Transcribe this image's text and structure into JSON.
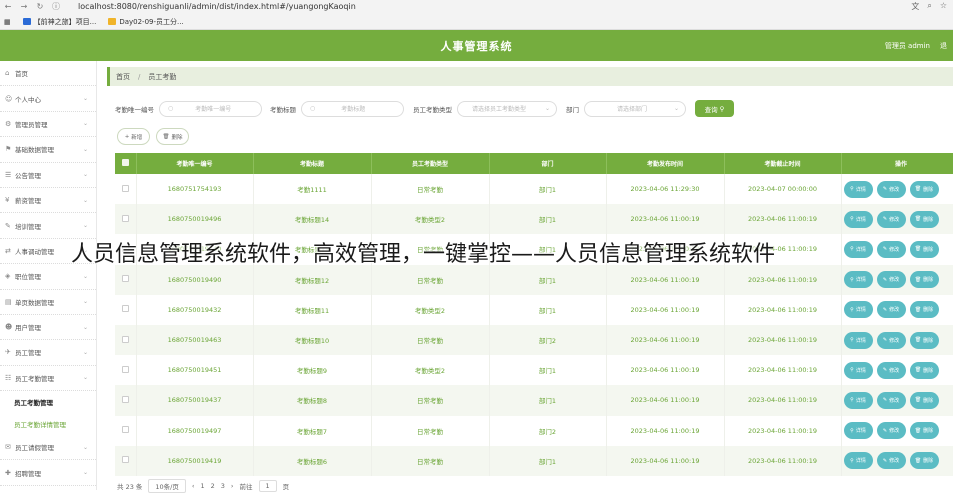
{
  "browser": {
    "url": "localhost:8080/renshiguanli/admin/dist/index.html#/yuangongKaoqin",
    "bookmarks": [
      "【前神之旅】项目...",
      "Day02-09-员工分..."
    ]
  },
  "header": {
    "title": "人事管理系统",
    "user": "管理员 admin",
    "logout": "退"
  },
  "sidebar": {
    "items": [
      {
        "label": "首页",
        "icon": "home-icon",
        "chevron": false
      },
      {
        "label": "个人中心",
        "icon": "user-icon",
        "chevron": true
      },
      {
        "label": "管理员管理",
        "icon": "admin-icon",
        "chevron": true
      },
      {
        "label": "基础数据管理",
        "icon": "flag-icon",
        "chevron": true
      },
      {
        "label": "公告管理",
        "icon": "notice-icon",
        "chevron": true
      },
      {
        "label": "薪资管理",
        "icon": "salary-icon",
        "chevron": true
      },
      {
        "label": "培训管理",
        "icon": "train-icon",
        "chevron": true
      },
      {
        "label": "人事调动管理",
        "icon": "transfer-icon",
        "chevron": true
      },
      {
        "label": "职位管理",
        "icon": "position-icon",
        "chevron": true
      },
      {
        "label": "单页数据管理",
        "icon": "page-icon",
        "chevron": true
      },
      {
        "label": "用户管理",
        "icon": "users-icon",
        "chevron": true
      },
      {
        "label": "员工管理",
        "icon": "staff-icon",
        "chevron": true
      },
      {
        "label": "员工考勤管理",
        "icon": "attendance-icon",
        "chevron": true
      }
    ],
    "sub_items": [
      "员工考勤管理",
      "员工考勤详情管理"
    ],
    "after_items": [
      {
        "label": "员工请假管理",
        "icon": "leave-icon",
        "chevron": true
      },
      {
        "label": "招聘管理",
        "icon": "recruit-icon",
        "chevron": true
      }
    ]
  },
  "breadcrumb": {
    "home": "首页",
    "current": "员工考勤"
  },
  "search": {
    "f1_label": "考勤唯一编号",
    "f1_placeholder": "考勤唯一编号",
    "f2_label": "考勤标题",
    "f2_placeholder": "考勤标题",
    "f3_label": "员工考勤类型",
    "f3_placeholder": "请选择员工考勤类型",
    "f4_label": "部门",
    "f4_placeholder": "请选择部门",
    "search_btn": "查询"
  },
  "actions": {
    "add": "新增",
    "delete": "删除"
  },
  "table": {
    "columns": [
      "考勤唯一编号",
      "考勤标题",
      "员工考勤类型",
      "部门",
      "考勤发布时间",
      "考勤截止时间",
      "操作"
    ],
    "rows": [
      [
        "1680751754193",
        "考勤1111",
        "日常考勤",
        "部门1",
        "2023-04-06 11:29:30",
        "2023-04-07 00:00:00"
      ],
      [
        "1680750019496",
        "考勤标题14",
        "考勤类型2",
        "部门1",
        "2023-04-06 11:00:19",
        "2023-04-06 11:00:19"
      ],
      [
        "1680750019440",
        "考勤标题13",
        "日常考勤",
        "部门1",
        "2023-04-06 11:00:19",
        "2023-04-06 11:00:19"
      ],
      [
        "1680750019490",
        "考勤标题12",
        "日常考勤",
        "部门1",
        "2023-04-06 11:00:19",
        "2023-04-06 11:00:19"
      ],
      [
        "1680750019432",
        "考勤标题11",
        "考勤类型2",
        "部门1",
        "2023-04-06 11:00:19",
        "2023-04-06 11:00:19"
      ],
      [
        "1680750019463",
        "考勤标题10",
        "日常考勤",
        "部门2",
        "2023-04-06 11:00:19",
        "2023-04-06 11:00:19"
      ],
      [
        "1680750019451",
        "考勤标题9",
        "考勤类型2",
        "部门1",
        "2023-04-06 11:00:19",
        "2023-04-06 11:00:19"
      ],
      [
        "1680750019437",
        "考勤标题8",
        "日常考勤",
        "部门1",
        "2023-04-06 11:00:19",
        "2023-04-06 11:00:19"
      ],
      [
        "1680750019497",
        "考勤标题7",
        "日常考勤",
        "部门2",
        "2023-04-06 11:00:19",
        "2023-04-06 11:00:19"
      ],
      [
        "1680750019419",
        "考勤标题6",
        "日常考勤",
        "部门1",
        "2023-04-06 11:00:19",
        "2023-04-06 11:00:19"
      ]
    ],
    "row_actions": [
      "详情",
      "修改",
      "删除"
    ]
  },
  "pager": {
    "total": "共 23 条",
    "page_size": "10条/页",
    "pages": [
      "1",
      "2",
      "3"
    ],
    "goto": "前往",
    "goto_value": "1",
    "page_unit": "页"
  },
  "overlay_text": "人员信息管理系统软件，高效管理，一键掌控——人员信息管理系统软件",
  "colors": {
    "primary": "#75ad3e",
    "action": "#5bbcc4",
    "text_green": "#6aa535"
  }
}
